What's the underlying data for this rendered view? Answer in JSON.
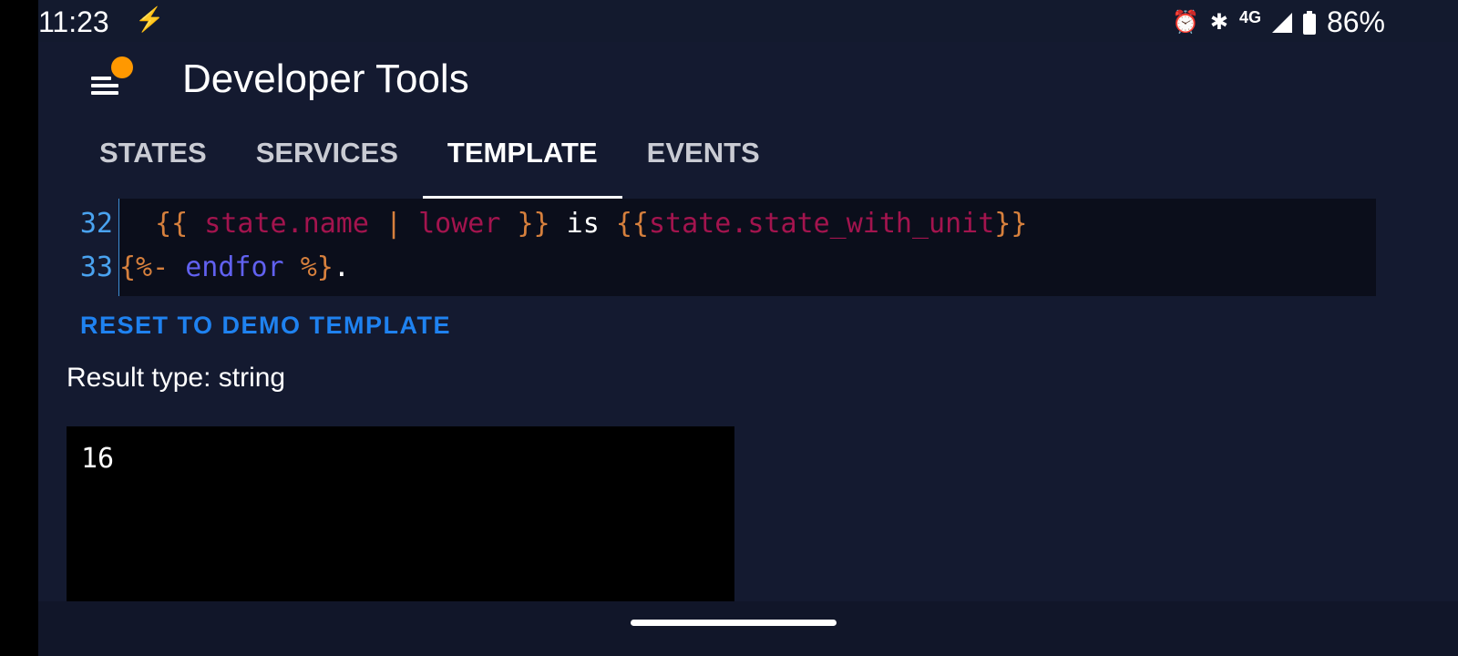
{
  "status_bar": {
    "time": "11:23",
    "icons": [
      "charging-bolt-icon",
      "alarm-icon",
      "bluetooth-icon",
      "signal-icon",
      "battery-icon"
    ],
    "network": "4G",
    "battery": "86%"
  },
  "header": {
    "title": "Developer Tools",
    "menu_icon": "menu-icon",
    "notification_color": "#ff9800"
  },
  "tabs": [
    {
      "label": "STATES"
    },
    {
      "label": "SERVICES"
    },
    {
      "label": "TEMPLATE",
      "active": true
    },
    {
      "label": "EVENTS"
    }
  ],
  "editor": {
    "lines": [
      {
        "number": "32",
        "tokens": [
          "  ",
          "{{",
          " state.name ",
          "|",
          " lower ",
          "}}",
          " is ",
          "{{",
          "state.state_with_unit",
          "}}"
        ]
      },
      {
        "number": "33",
        "tokens": [
          "{%-",
          " endfor ",
          "%}",
          "."
        ]
      }
    ]
  },
  "reset_button": "RESET TO DEMO TEMPLATE",
  "result_type": "Result type: string",
  "result_value": "16"
}
